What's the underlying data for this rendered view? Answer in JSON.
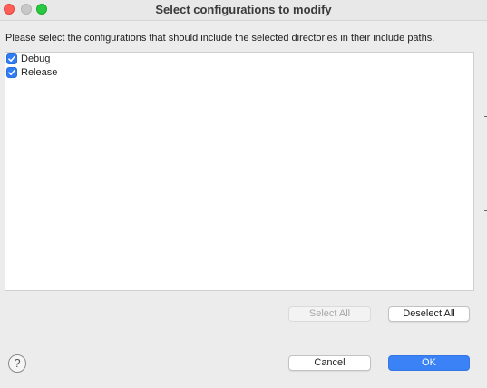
{
  "window": {
    "title": "Select configurations to modify"
  },
  "instructions": "Please select the configurations that should include the selected directories in their include paths.",
  "configurations": [
    {
      "label": "Debug",
      "checked": true
    },
    {
      "label": "Release",
      "checked": true
    }
  ],
  "buttons": {
    "select_all": "Select All",
    "deselect_all": "Deselect All",
    "cancel": "Cancel",
    "ok": "OK"
  },
  "help": {
    "glyph": "?"
  },
  "colors": {
    "accent": "#3b82f6",
    "close": "#fe5f57",
    "zoom": "#28c840"
  }
}
